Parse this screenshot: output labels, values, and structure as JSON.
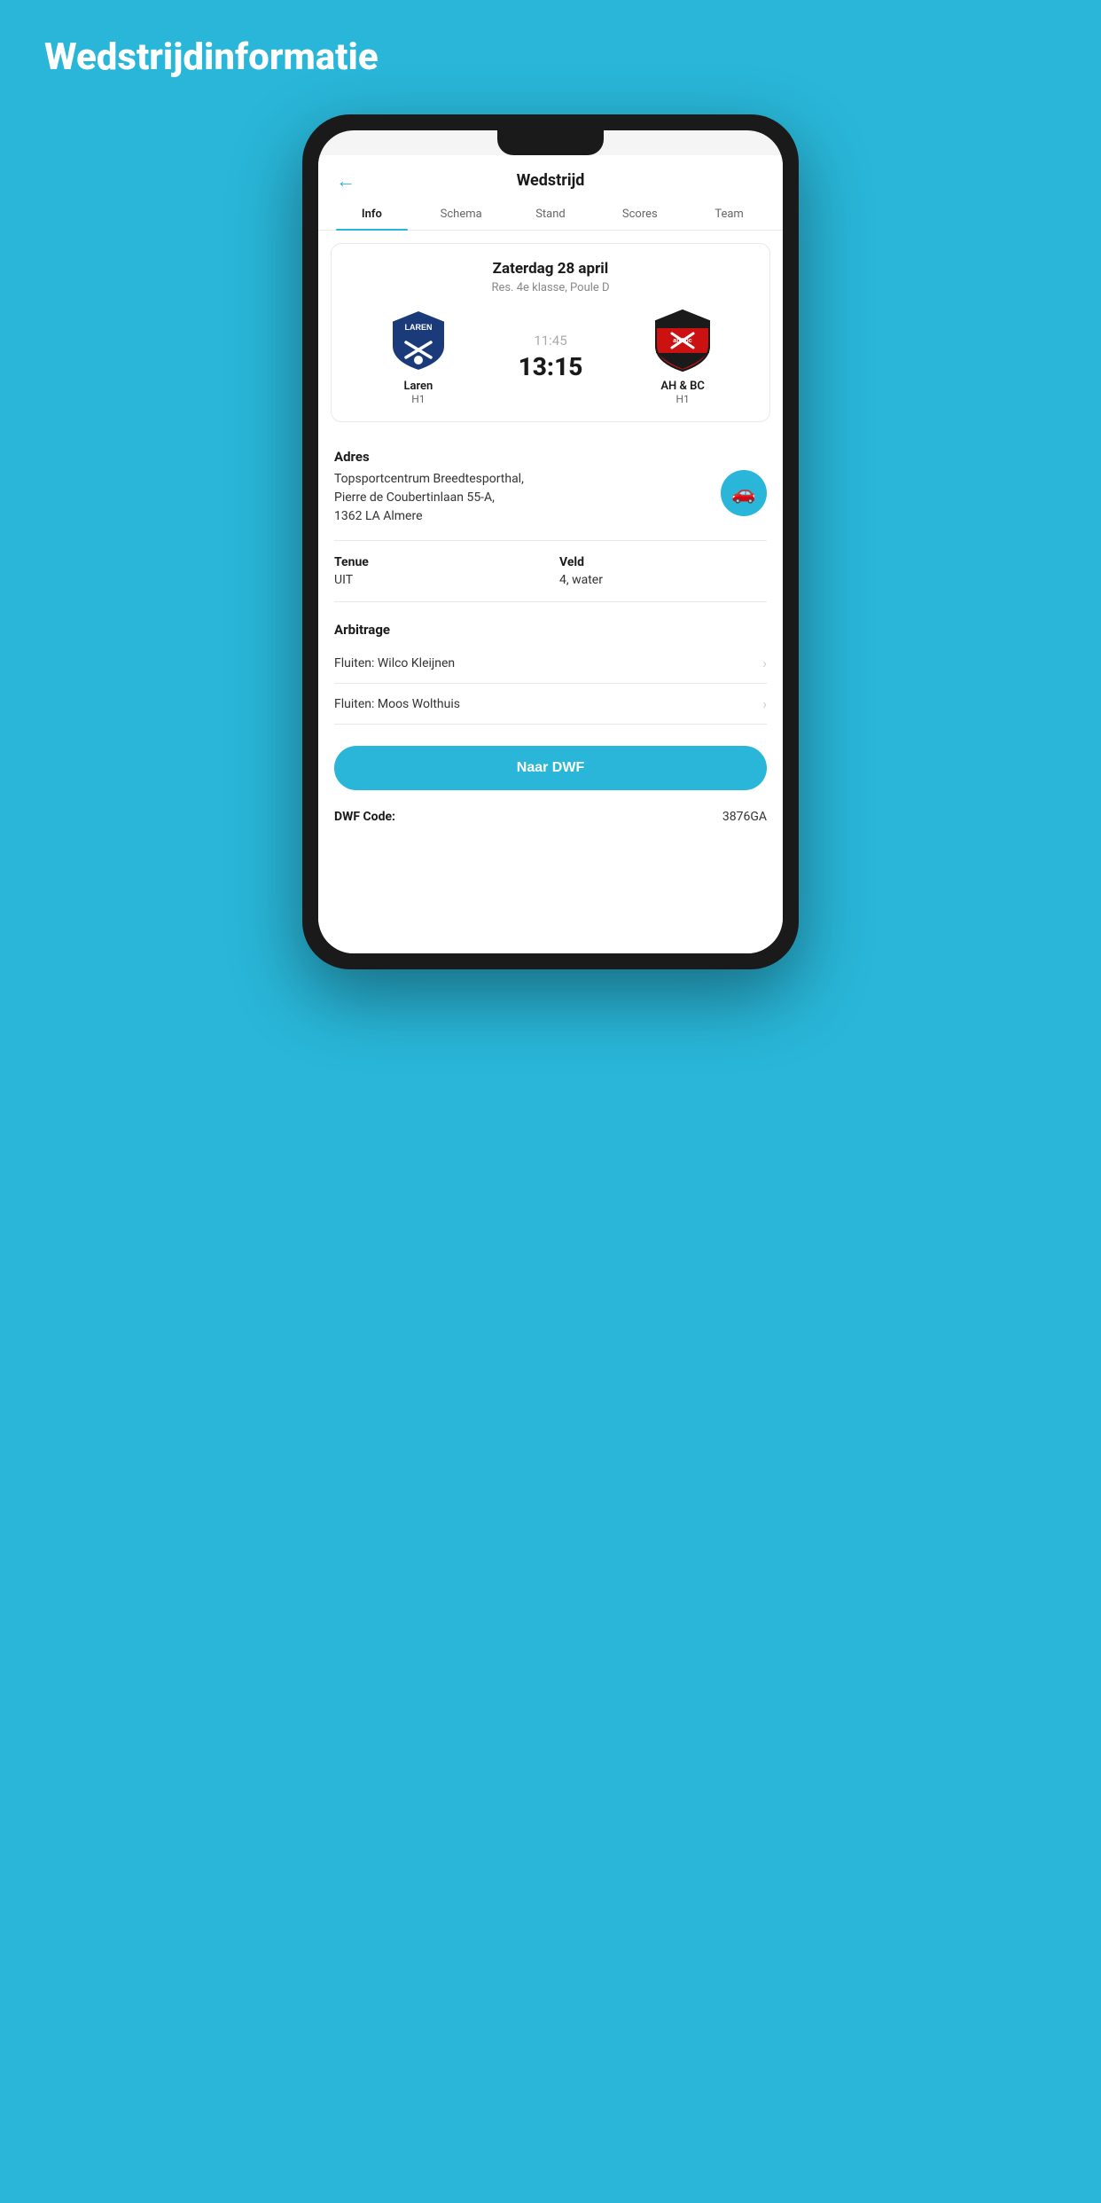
{
  "page": {
    "title": "Wedstrijdinformatie",
    "background_color": "#29b6d8"
  },
  "app": {
    "header": {
      "back_label": "←",
      "title": "Wedstrijd"
    },
    "tabs": [
      {
        "id": "info",
        "label": "Info",
        "active": true
      },
      {
        "id": "schema",
        "label": "Schema",
        "active": false
      },
      {
        "id": "stand",
        "label": "Stand",
        "active": false
      },
      {
        "id": "scores",
        "label": "Scores",
        "active": false
      },
      {
        "id": "team",
        "label": "Team",
        "active": false
      }
    ],
    "match": {
      "date": "Zaterdag 28 april",
      "league": "Res. 4e klasse, Poule D",
      "home_team": {
        "name": "Laren",
        "sub": "H1"
      },
      "away_team": {
        "name": "AH & BC",
        "sub": "H1"
      },
      "score_time": "11:45",
      "score_main": "13:15"
    },
    "address": {
      "label": "Adres",
      "text": "Topsportcentrum Breedtesporthal,\nPierre de Coubertinlaan 55-A,\n1362 LA Almere"
    },
    "tenue": {
      "label": "Tenue",
      "value": "UIT"
    },
    "veld": {
      "label": "Veld",
      "value": "4, water"
    },
    "arbitrage": {
      "label": "Arbitrage",
      "items": [
        {
          "text": "Fluiten: Wilco Kleijnen"
        },
        {
          "text": "Fluiten: Moos Wolthuis"
        }
      ]
    },
    "cta": {
      "label": "Naar DWF"
    },
    "dwf": {
      "label": "DWF Code:",
      "value": "3876GA"
    }
  }
}
